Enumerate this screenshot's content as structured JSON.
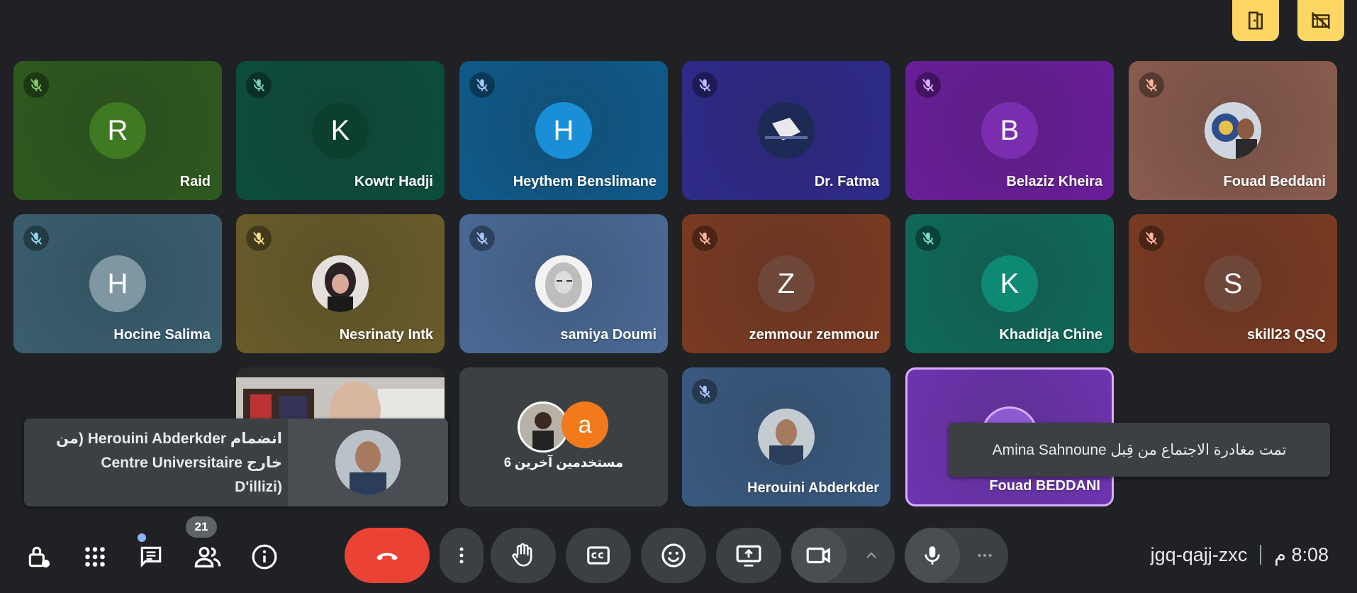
{
  "top_buttons": {
    "door_label": "",
    "layout_label": ""
  },
  "participants": [
    {
      "name": "Raid",
      "initial": "R",
      "bg": "#2e5a1e",
      "avatar_bg": "#3f7a23"
    },
    {
      "name": "Kowtr Hadji",
      "initial": "K",
      "bg": "#0c4d3c",
      "avatar_bg": "#0d3f2f"
    },
    {
      "name": "Heythem Benslimane",
      "initial": "H",
      "bg": "#0f5a8a",
      "avatar_bg": "#1a8fd8"
    },
    {
      "name": "Dr. Fatma",
      "initial": "",
      "bg": "#2e2a8a",
      "avatar_bg": "#2a3f7a"
    },
    {
      "name": "Belaziz Kheira",
      "initial": "B",
      "bg": "#6a1e9a",
      "avatar_bg": "#7b2db0"
    },
    {
      "name": "Fouad Beddani",
      "initial": "",
      "bg": "#8a5c4e",
      "avatar_bg": "#5a8fbf"
    },
    {
      "name": "Hocine Salima",
      "initial": "H",
      "bg": "#3a5f70",
      "avatar_bg": "#7f97a3"
    },
    {
      "name": "Nesrinaty Intk",
      "initial": "",
      "bg": "#6a5c2a",
      "avatar_bg": "#c9a9a0"
    },
    {
      "name": "samiya Doumi",
      "initial": "",
      "bg": "#4a6a96",
      "avatar_bg": "#dddddd"
    },
    {
      "name": "zemmour zemmour",
      "initial": "Z",
      "bg": "#7a3a22",
      "avatar_bg": "#6e4738"
    },
    {
      "name": "Khadidja Chine",
      "initial": "K",
      "bg": "#0f6a5a",
      "avatar_bg": "#0e8a74"
    },
    {
      "name": "skill23 QSQ",
      "initial": "S",
      "bg": "#7a3a22",
      "avatar_bg": "#6e4738"
    },
    {
      "name": "Herouini Abderkder",
      "initial": "",
      "bg": "#3a5a80",
      "avatar_bg": "#6f7f8a"
    },
    {
      "name": "Fouad BEDDANI",
      "initial": "",
      "bg": "#6e34b0",
      "avatar_bg": "#7d49c4"
    }
  ],
  "others_tile": {
    "label": "6 مستخدمين آخرين",
    "avatar_initial": "a",
    "avatar_bg": "#f27a1a"
  },
  "toast_join": {
    "line1": "انضمام Herouini Abderkder (من",
    "line2": "خارج Centre Universitaire",
    "line3": "(D'illizi"
  },
  "toast_leave": {
    "text": "تمت مغادرة الاجتماع من قِبل Amina Sahnoune"
  },
  "toolbar": {
    "people_count": "21",
    "meeting_code": "jgq-qajj-zxc",
    "time": "8:08 م"
  },
  "colors": {
    "accent_yellow": "#fdd663",
    "end_call": "#ea4335",
    "background": "#202124"
  }
}
